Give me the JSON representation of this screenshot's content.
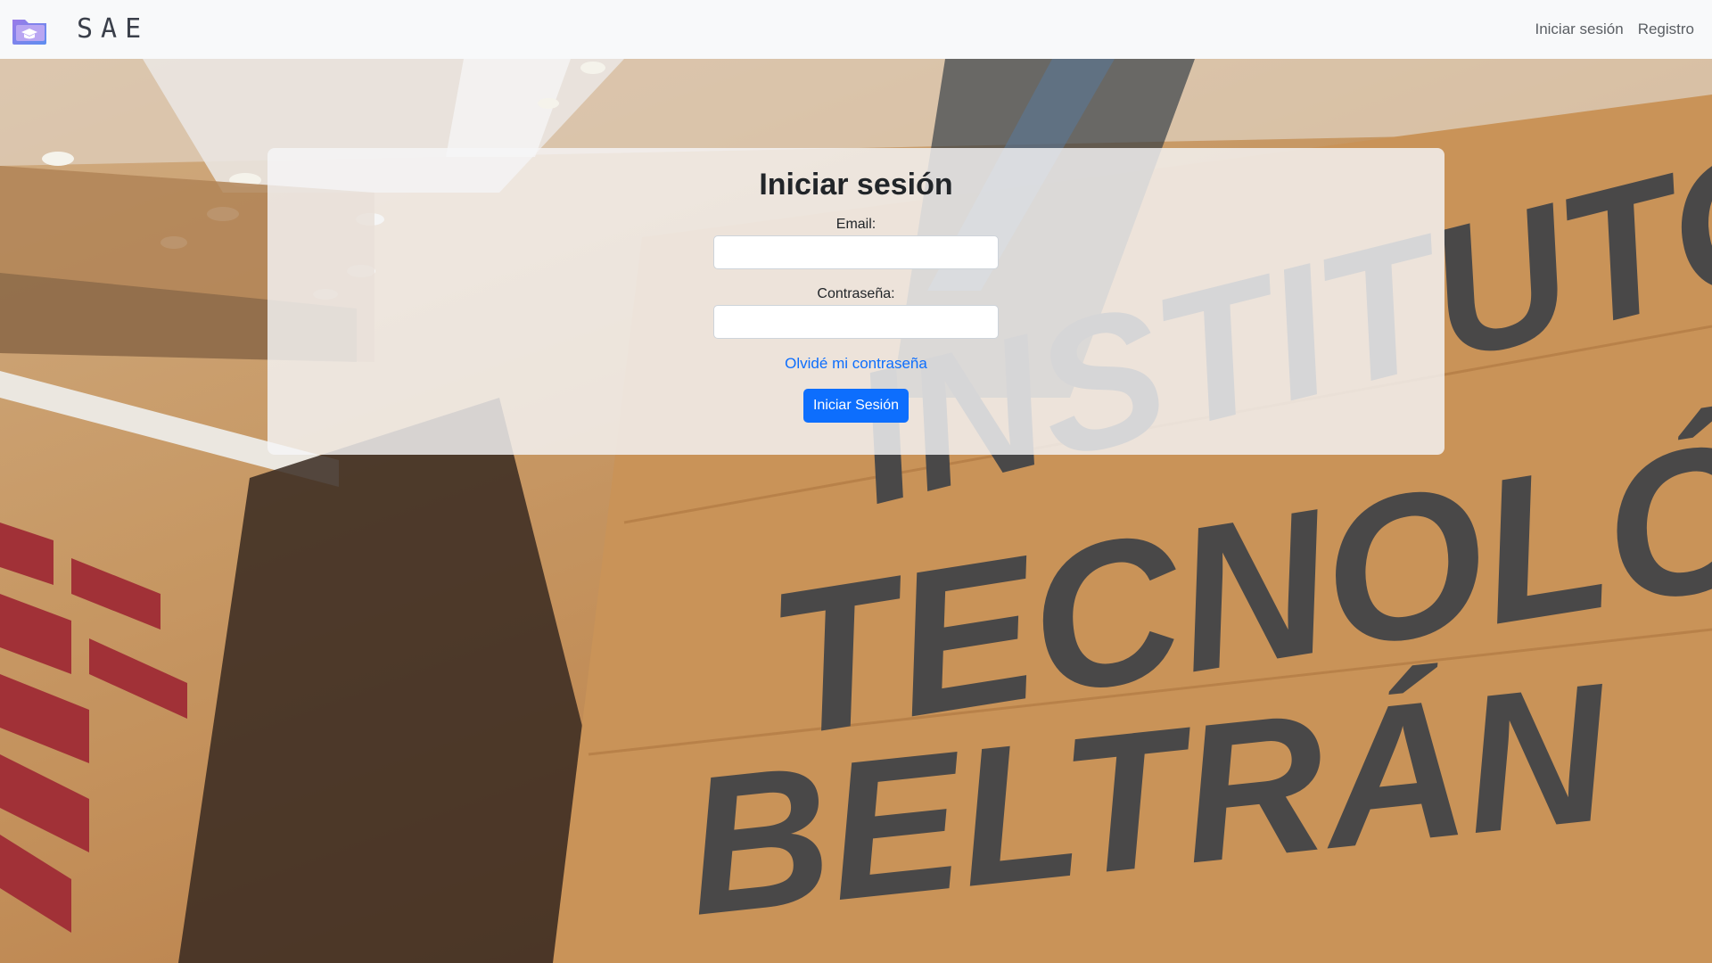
{
  "navbar": {
    "brand": "SAE",
    "links": [
      "Iniciar sesión",
      "Registro"
    ]
  },
  "login": {
    "title": "Iniciar sesión",
    "email_label": "Email:",
    "email_value": "",
    "password_label": "Contraseña:",
    "password_value": "",
    "forgot_link": "Olvidé mi contraseña",
    "submit_label": "Iniciar Sesión"
  },
  "background": {
    "sign_lines": [
      "INSTITUTO",
      "TECNOLÓGICO",
      "BELTRÁN"
    ]
  },
  "colors": {
    "primary": "#0d6efd",
    "navbar_bg": "#f8f9fa",
    "logo_purple": "#7b5cd6"
  }
}
